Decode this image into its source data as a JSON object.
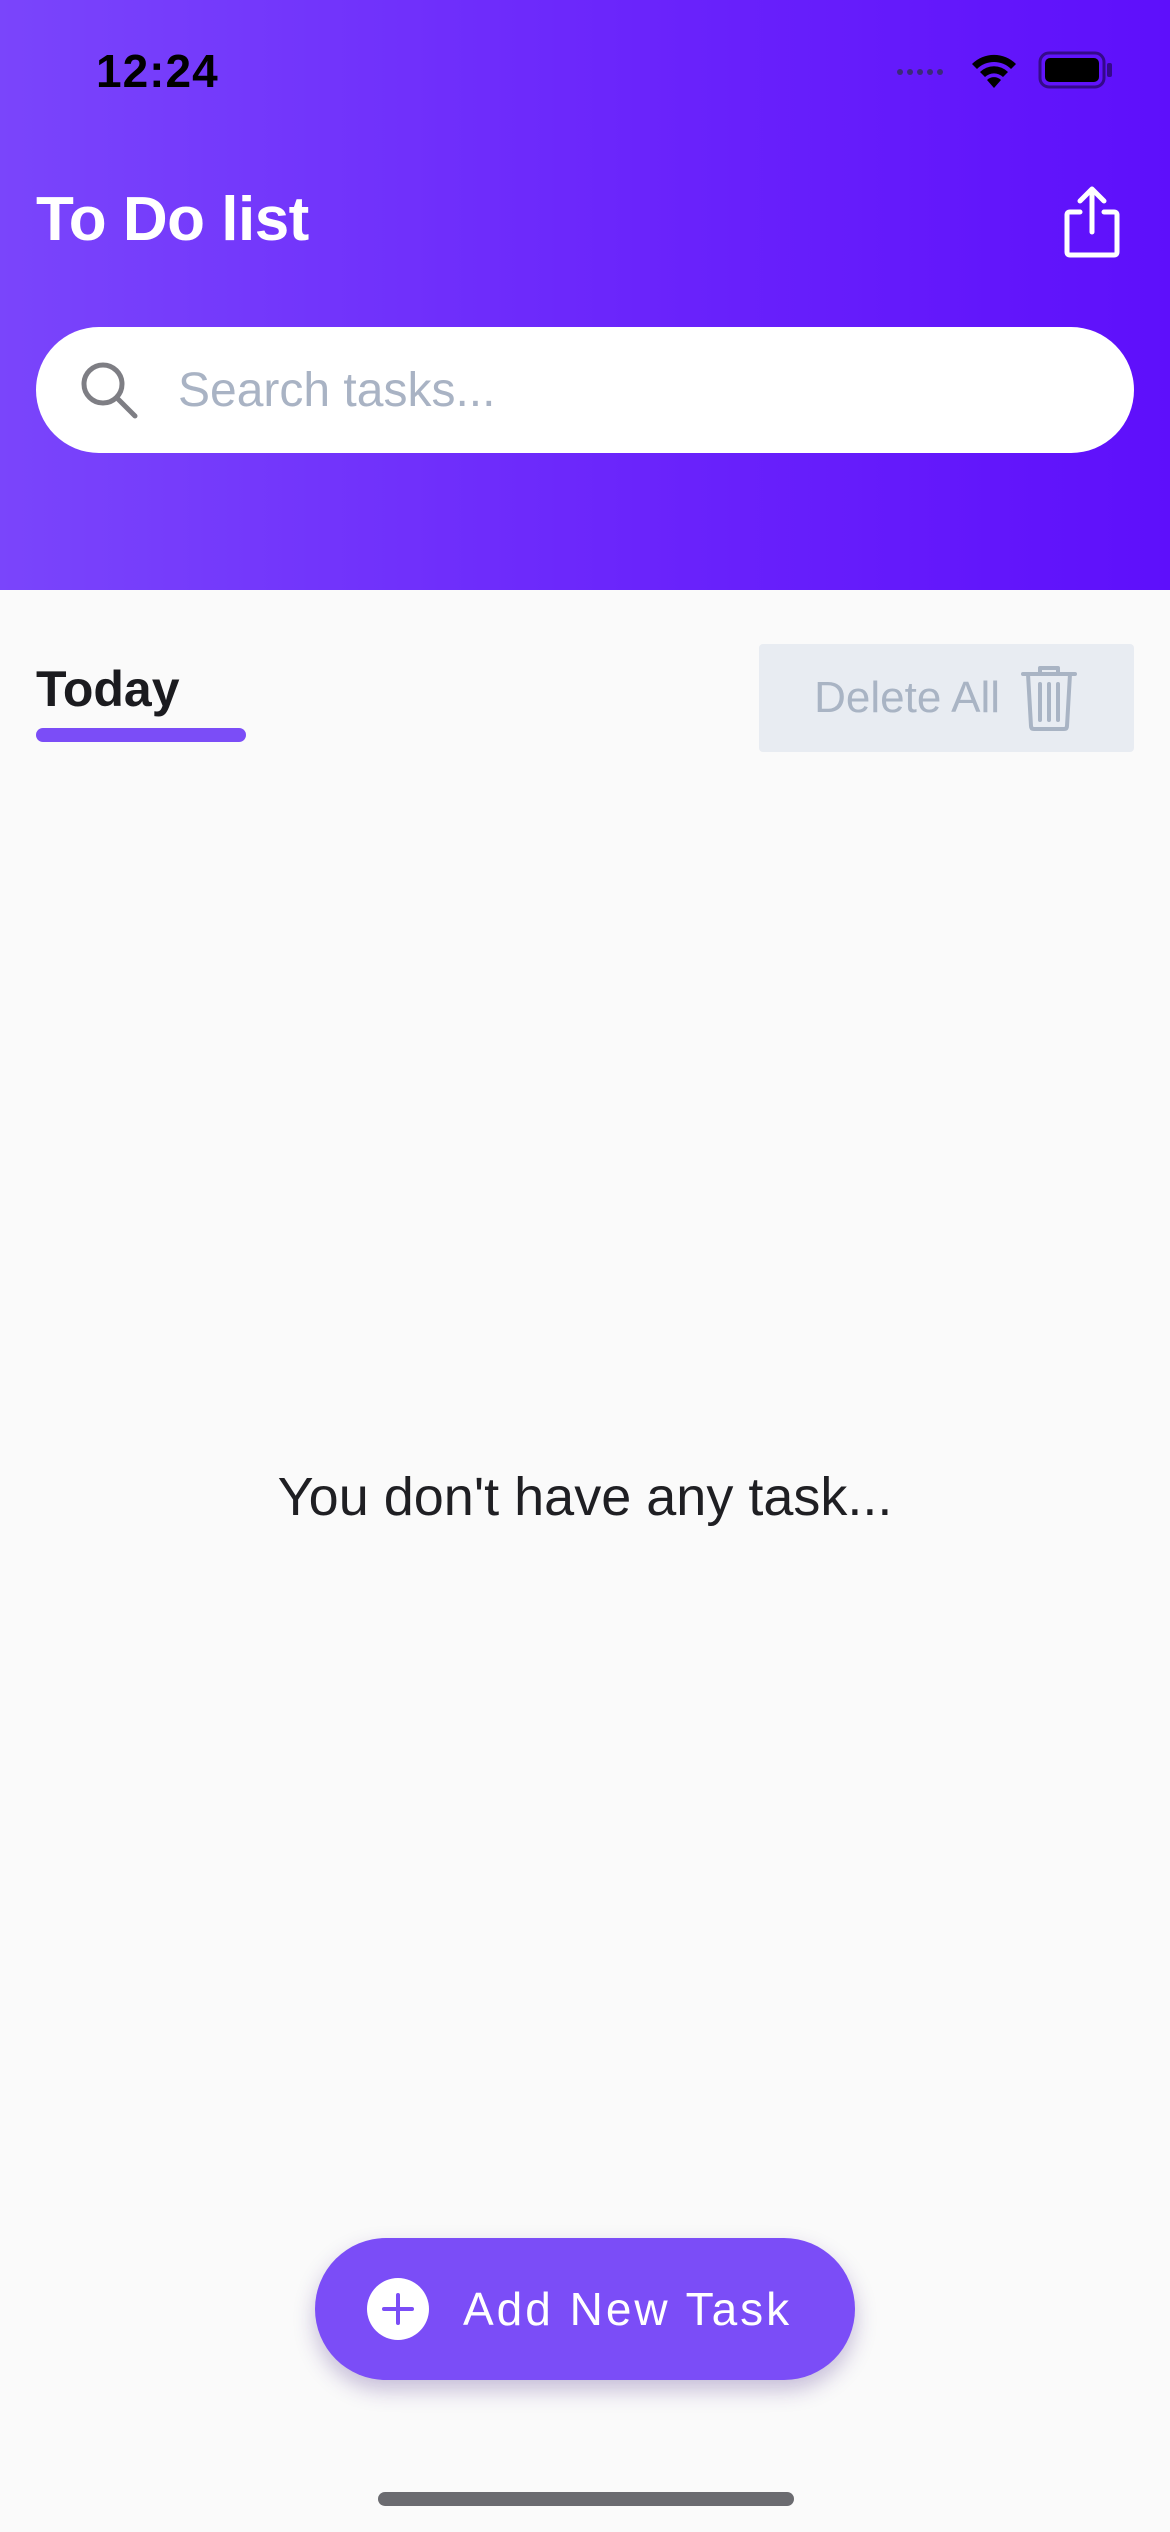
{
  "status_bar": {
    "time": "12:24"
  },
  "header": {
    "title": "To Do list",
    "share_icon": "share-icon"
  },
  "search": {
    "placeholder": "Search tasks...",
    "value": "",
    "icon": "search-icon"
  },
  "tabs": {
    "active_label": "Today"
  },
  "actions": {
    "delete_all_label": "Delete All",
    "delete_icon": "trash-icon"
  },
  "empty_state": {
    "message": "You don't have any task..."
  },
  "fab": {
    "label": "Add New Task",
    "icon": "plus-icon"
  },
  "colors": {
    "header_gradient_start": "#7a45fb",
    "header_gradient_end": "#5e0ffb",
    "accent": "#7b4df7",
    "background": "#fafafa",
    "disabled_button_bg": "#e8ecf2",
    "disabled_text": "#a9b4c4"
  }
}
